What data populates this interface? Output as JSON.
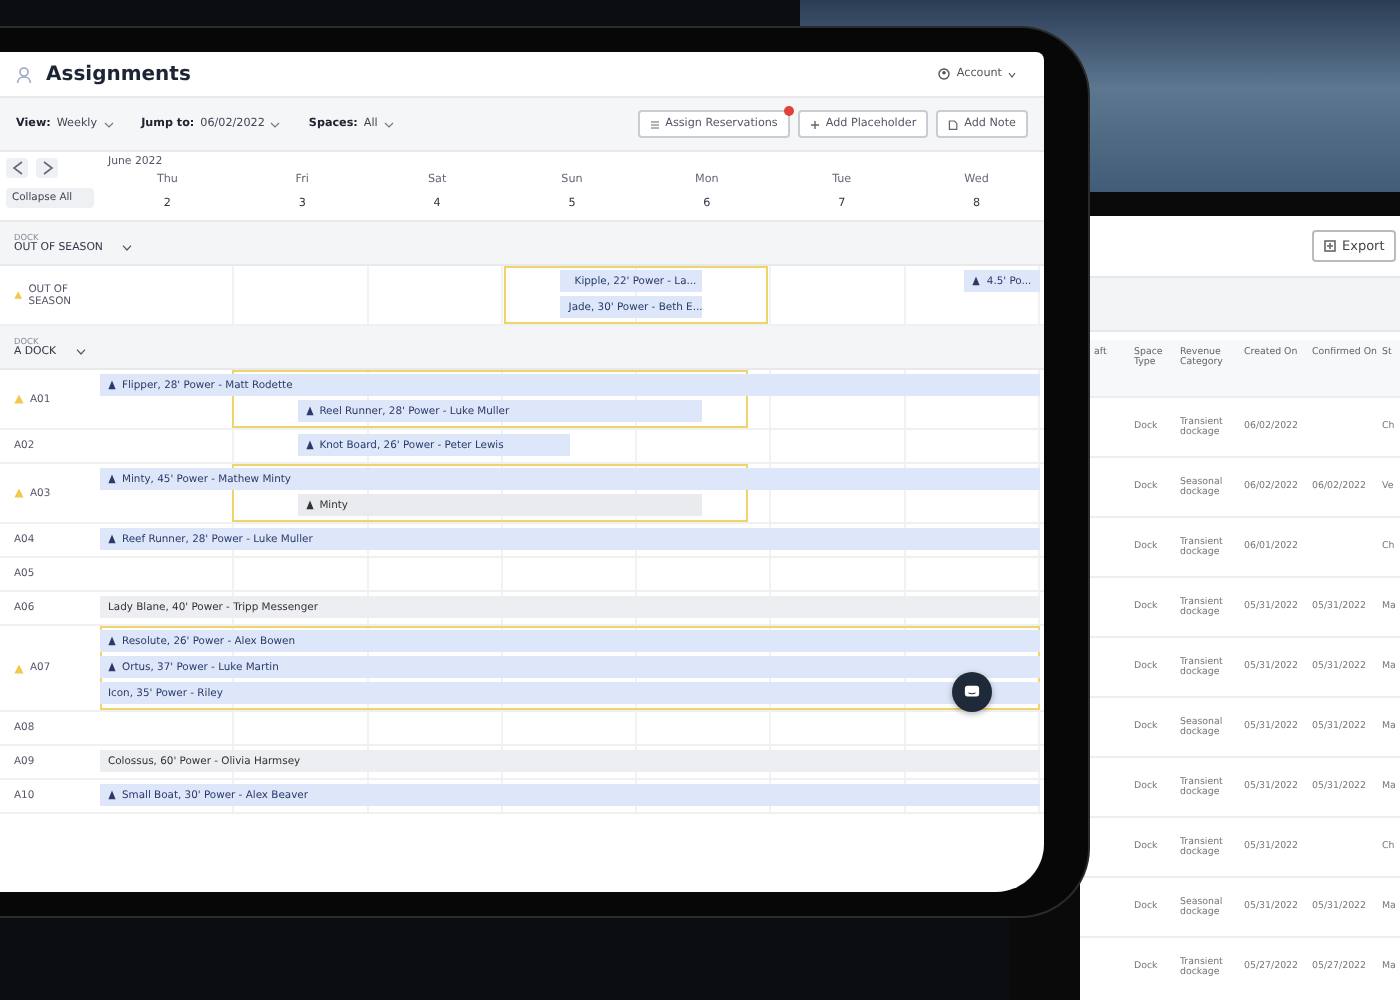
{
  "schedule_tablet": {
    "title": "Assignments",
    "account": "Account",
    "filters": [
      {
        "label": "View:",
        "value": "Weekly"
      },
      {
        "label": "Jump to:",
        "value": "06/02/2022"
      },
      {
        "label": "Spaces:",
        "value": "All"
      }
    ],
    "actions": [
      {
        "label": "Assign Reservations",
        "notification": true
      },
      {
        "label": "Add Placeholder",
        "notification": false
      },
      {
        "label": "Add Note",
        "notification": false
      }
    ],
    "month": "June 2022",
    "collapse_button": "Collapse All",
    "days": [
      {
        "weekday": "Thu",
        "date": "2"
      },
      {
        "weekday": "Fri",
        "date": "3"
      },
      {
        "weekday": "Sat",
        "date": "4"
      },
      {
        "weekday": "Sun",
        "date": "5"
      },
      {
        "weekday": "Mon",
        "date": "6"
      },
      {
        "weekday": "Tue",
        "date": "7"
      },
      {
        "weekday": "Wed",
        "date": "8"
      }
    ],
    "groups": [
      {
        "caption": "DOCK",
        "name": "OUT OF SEASON",
        "expanded": true,
        "rows": [
          {
            "space": "OUT OF SEASON",
            "warning": true,
            "bookings": [
              {
                "kind": "reservation",
                "text": "Kipple, 22' Power - La..."
              },
              {
                "kind": "tentative",
                "text": "Jade, 30' Power - Beth E..."
              },
              {
                "kind": "reservation",
                "text": "4.5' Po..."
              }
            ]
          }
        ]
      },
      {
        "caption": "DOCK",
        "name": "A DOCK",
        "expanded": true,
        "rows": [
          {
            "space": "A01",
            "warning": true,
            "bookings": [
              {
                "kind": "reservation",
                "text": "Flipper, 28' Power - Matt Rodette"
              },
              {
                "kind": "reservation",
                "text": "Reel Runner, 28' Power - Luke Muller"
              }
            ]
          },
          {
            "space": "A02",
            "warning": false,
            "bookings": [
              {
                "kind": "reservation",
                "text": "Knot Board, 26' Power - Peter Lewis"
              }
            ]
          },
          {
            "space": "A03",
            "warning": true,
            "bookings": [
              {
                "kind": "reservation",
                "text": "Minty, 45' Power - Mathew Minty"
              },
              {
                "kind": "placeholder",
                "text": "Minty"
              }
            ]
          },
          {
            "space": "A04",
            "warning": false,
            "bookings": [
              {
                "kind": "reservation",
                "text": "Reef Runner, 28' Power - Luke Muller"
              }
            ]
          },
          {
            "space": "A05",
            "warning": false,
            "bookings": []
          },
          {
            "space": "A06",
            "warning": false,
            "bookings": [
              {
                "kind": "note",
                "text": "Lady Blane, 40' Power - Tripp Messenger"
              }
            ]
          },
          {
            "space": "A07",
            "warning": true,
            "bookings": [
              {
                "kind": "reservation",
                "text": "Resolute, 26' Power - Alex Bowen"
              },
              {
                "kind": "reservation",
                "text": "Ortus, 37' Power - Luke Martin"
              },
              {
                "kind": "tentative",
                "text": "Icon, 35' Power - Riley"
              }
            ]
          },
          {
            "space": "A08",
            "warning": false,
            "bookings": []
          },
          {
            "space": "A09",
            "warning": false,
            "bookings": [
              {
                "kind": "note",
                "text": "Colossus, 60' Power - Olivia Harmsey"
              }
            ]
          },
          {
            "space": "A10",
            "warning": false,
            "bookings": [
              {
                "kind": "reservation",
                "text": "Small Boat, 30' Power - Alex Beaver"
              }
            ]
          }
        ]
      }
    ]
  },
  "report_tablet": {
    "export_button": "Export",
    "columns": [
      "aft",
      "Space Type",
      "Revenue Category",
      "Created On",
      "Confirmed On",
      "St"
    ],
    "rows": [
      {
        "space_type": "Dock",
        "revenue_category": "Transient dockage",
        "created_on": "06/02/2022",
        "column_6": "Ch"
      },
      {
        "space_type": "Dock",
        "revenue_category": "Seasonal dockage",
        "created_on": "06/02/2022",
        "confirmed_on": "06/02/2022",
        "column_6": "Ve"
      },
      {
        "space_type": "Dock",
        "revenue_category": "Transient dockage",
        "created_on": "06/01/2022",
        "column_6": "Ch"
      },
      {
        "space_type": "Dock",
        "revenue_category": "Transient dockage",
        "created_on": "05/31/2022",
        "confirmed_on": "05/31/2022",
        "column_6": "Ma"
      },
      {
        "space_type": "Dock",
        "revenue_category": "Transient dockage",
        "created_on": "05/31/2022",
        "confirmed_on": "05/31/2022",
        "column_6": "Ma"
      },
      {
        "space_type": "Dock",
        "revenue_category": "Seasonal dockage",
        "created_on": "05/31/2022",
        "confirmed_on": "05/31/2022",
        "column_6": "Ma"
      },
      {
        "space_type": "Dock",
        "revenue_category": "Transient dockage",
        "created_on": "05/31/2022",
        "confirmed_on": "05/31/2022",
        "column_6": "Ma"
      },
      {
        "space_type": "Dock",
        "revenue_category": "Transient dockage",
        "created_on": "05/31/2022",
        "column_6": "Ch"
      },
      {
        "space_type": "Dock",
        "revenue_category": "Seasonal dockage",
        "created_on": "05/31/2022",
        "confirmed_on": "05/31/2022",
        "column_6": "Ma"
      },
      {
        "space_type": "Dock",
        "revenue_category": "Transient dockage",
        "created_on": "05/27/2022",
        "confirmed_on": "05/27/2022",
        "column_6": "Ma"
      }
    ]
  }
}
